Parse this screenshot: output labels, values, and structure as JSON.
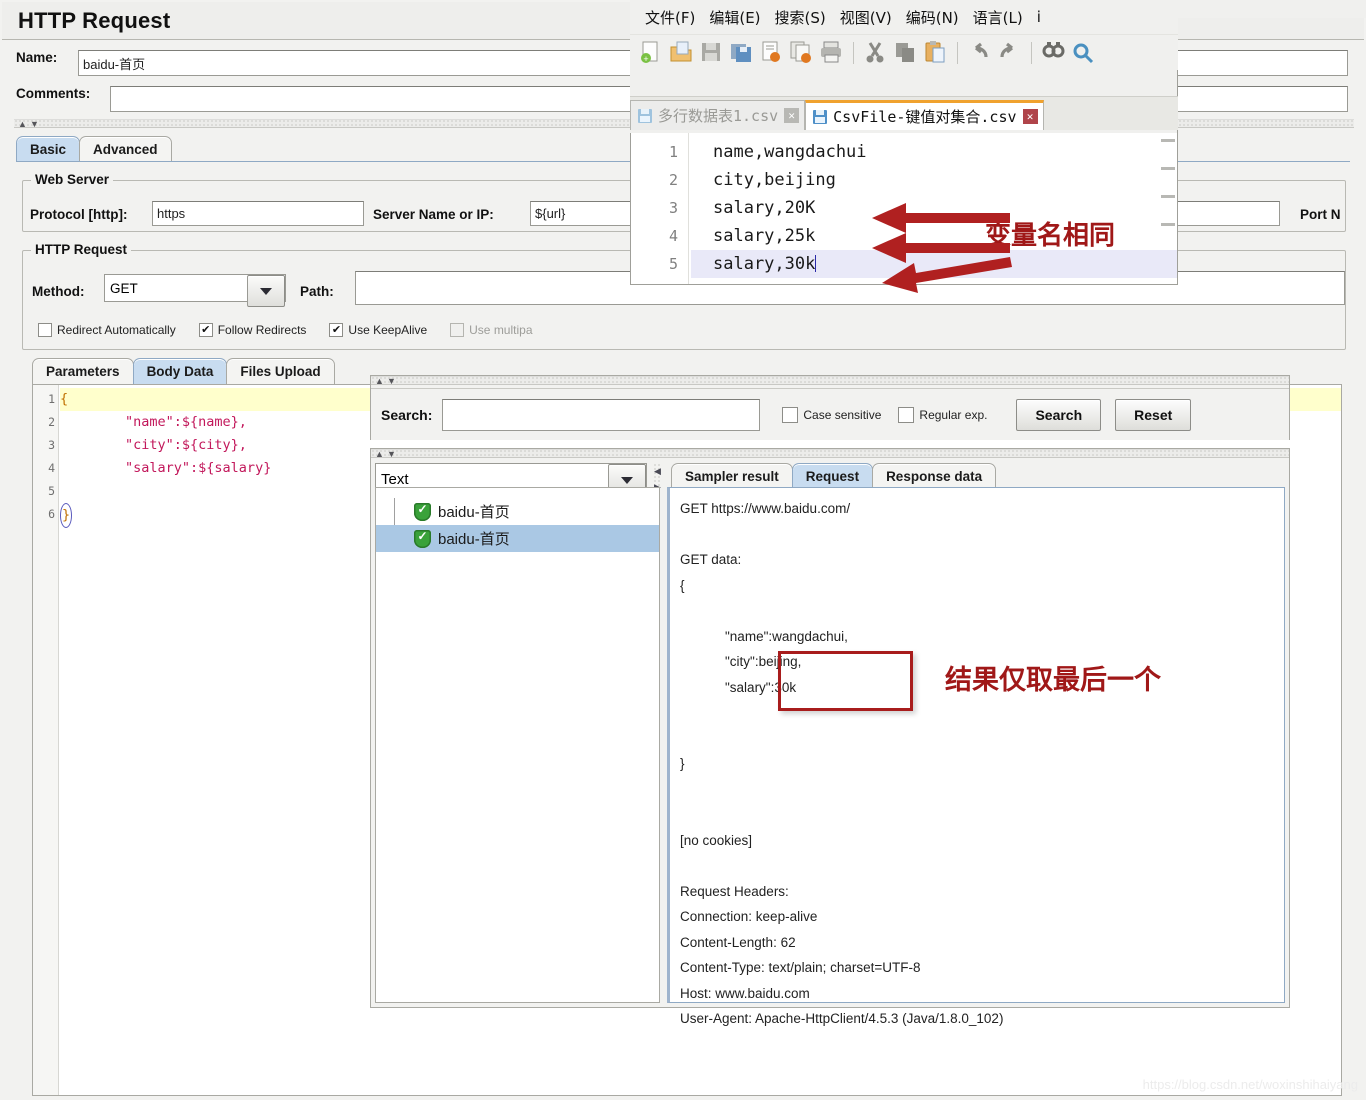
{
  "jmeter": {
    "title": "HTTP Request",
    "name_label": "Name:",
    "name_value": "baidu-首页",
    "comments_label": "Comments:",
    "comments_value": "",
    "tabs": [
      {
        "label": "Basic",
        "active": true
      },
      {
        "label": "Advanced",
        "active": false
      }
    ],
    "web_server": {
      "group_title": "Web Server",
      "protocol_label": "Protocol [http]:",
      "protocol_value": "https",
      "server_label": "Server Name or IP:",
      "server_value": "${url}",
      "port_label": "Port N"
    },
    "http_request": {
      "group_title": "HTTP Request",
      "method_label": "Method:",
      "method_value": "GET",
      "path_label": "Path:",
      "path_value": "",
      "checkboxes": [
        {
          "label": "Redirect Automatically",
          "checked": false,
          "disabled": false
        },
        {
          "label": "Follow Redirects",
          "checked": true,
          "disabled": false
        },
        {
          "label": "Use KeepAlive",
          "checked": true,
          "disabled": false
        },
        {
          "label": "Use multipa",
          "checked": false,
          "disabled": true
        }
      ],
      "tabs": [
        {
          "label": "Parameters",
          "active": false
        },
        {
          "label": "Body Data",
          "active": true
        },
        {
          "label": "Files Upload",
          "active": false
        }
      ]
    },
    "body_data": {
      "line_numbers": [
        "1",
        "2",
        "3",
        "4",
        "5",
        "6"
      ],
      "lines": [
        "{",
        "        \"name\":${name},",
        "        \"city\":${city},",
        "        \"salary\":${salary}",
        "",
        "}"
      ]
    }
  },
  "notepadpp": {
    "menu": [
      "文件(F)",
      "编辑(E)",
      "搜索(S)",
      "视图(V)",
      "编码(N)",
      "语言(L)",
      "i"
    ],
    "toolbar_icons": [
      "new-file-icon",
      "open-file-icon",
      "save-icon",
      "save-all-icon",
      "close-file-icon",
      "close-all-icon",
      "print-icon",
      "cut-icon",
      "copy-icon",
      "paste-icon",
      "undo-icon",
      "redo-icon",
      "find-icon",
      "replace-icon"
    ],
    "tabs": [
      {
        "label": "多行数据表1.csv",
        "active": false
      },
      {
        "label": "CsvFile-键值对集合.csv",
        "active": true
      }
    ],
    "close_glyph": "✕",
    "editor": {
      "line_numbers": [
        "1",
        "2",
        "3",
        "4",
        "5"
      ],
      "lines": [
        "name,wangdachui",
        "city,beijing",
        "salary,20K",
        "salary,25k",
        "salary,30k"
      ],
      "current_line_index": 4
    }
  },
  "annotations": {
    "csv_note": "变量名相同",
    "result_note": "结果仅取最后一个"
  },
  "search_panel": {
    "search_label": "Search:",
    "search_value": "",
    "case_sensitive_label": "Case sensitive",
    "case_sensitive_checked": false,
    "regular_exp_label": "Regular exp.",
    "regular_exp_checked": false,
    "search_button": "Search",
    "reset_button": "Reset"
  },
  "results_panel": {
    "view_selector_value": "Text",
    "tree_items": [
      {
        "label": "baidu-首页",
        "selected": false,
        "status": "success"
      },
      {
        "label": "baidu-首页",
        "selected": true,
        "status": "success"
      }
    ],
    "tabs": [
      {
        "label": "Sampler result",
        "active": false
      },
      {
        "label": "Request",
        "active": true
      },
      {
        "label": "Response data",
        "active": false
      }
    ],
    "request_text": "GET https://www.baidu.com/\n\nGET data:\n{\n\n            \"name\":wangdachui,\n            \"city\":beijing,\n            \"salary\":30k\n\n\n}\n\n\n[no cookies]\n\nRequest Headers:\nConnection: keep-alive\nContent-Length: 62\nContent-Type: text/plain; charset=UTF-8\nHost: www.baidu.com\nUser-Agent: Apache-HttpClient/4.5.3 (Java/1.8.0_102)"
  },
  "watermark": "https://blog.csdn.net/woxinshihaiyang",
  "colors": {
    "annotation_red": "#a01818",
    "box_red": "#a81c1c",
    "tab_active": "#c8dcf0",
    "npp_tab_accent": "#f0a22e",
    "success_green": "#3aa23a",
    "selection_blue": "#aac8e4"
  }
}
